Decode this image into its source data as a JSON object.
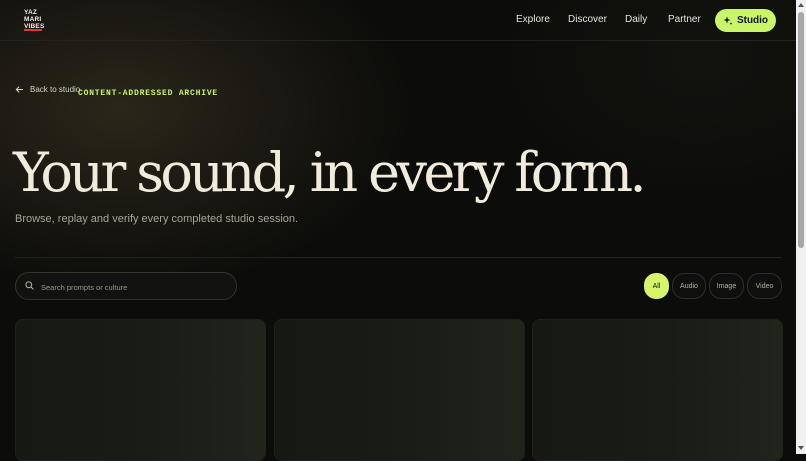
{
  "brand": {
    "logo_lines": [
      "YAZ",
      "MARI",
      "VIBES"
    ]
  },
  "nav": {
    "links": [
      "Explore",
      "Discover",
      "Daily",
      "Partner"
    ],
    "studio_label": "Studio"
  },
  "hero": {
    "back_label": "Back to studio",
    "eyebrow": "CONTENT-ADDRESSED ARCHIVE",
    "title": "Your sound, in every form.",
    "subtitle": "Browse, replay and verify every completed studio session."
  },
  "search": {
    "placeholder": "Search prompts or culture",
    "value": ""
  },
  "filters": {
    "options": [
      "All",
      "Audio",
      "Image",
      "Video"
    ],
    "selected": "All"
  },
  "colors": {
    "accent": "#c9f56a",
    "background": "#0c0c0a",
    "logo_underline": "#d13b3b"
  },
  "icons": {
    "back": "arrow-left-icon",
    "studio": "sparkle-icon",
    "search": "search-icon"
  }
}
